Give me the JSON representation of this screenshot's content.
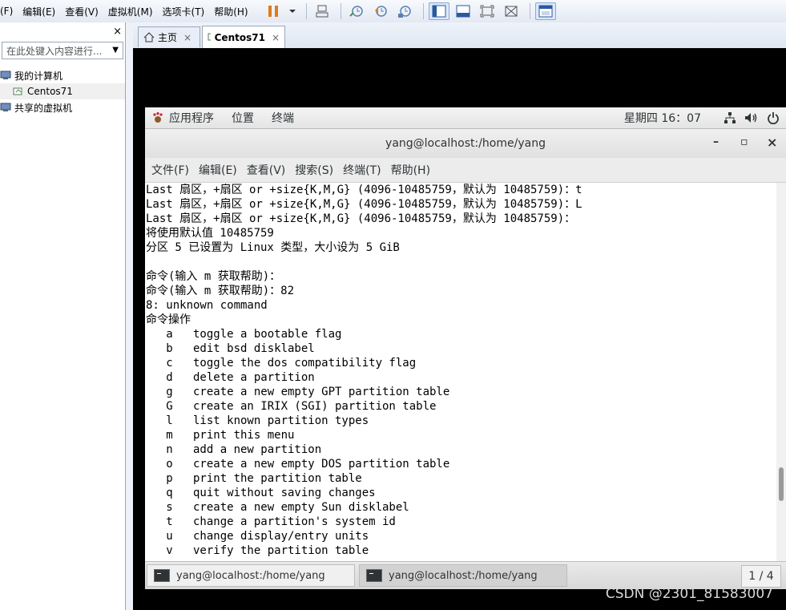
{
  "vmware": {
    "menu": [
      "(F)",
      "编辑(E)",
      "查看(V)",
      "虚拟机(M)",
      "选项卡(T)",
      "帮助(H)"
    ],
    "library": {
      "close": "×",
      "search_placeholder": "在此处键入内容进行...",
      "tree": [
        {
          "label": "我的计算机"
        },
        {
          "label": "Centos71"
        },
        {
          "label": "共享的虚拟机"
        }
      ]
    },
    "tabs": [
      {
        "label": "主页",
        "close": "×"
      },
      {
        "label": "Centos71",
        "close": "×"
      }
    ]
  },
  "gnome": {
    "topbar": {
      "apps": "应用程序",
      "places": "位置",
      "terminal": "终端",
      "clock": "星期四 16：07"
    },
    "window": {
      "title": "yang@localhost:/home/yang",
      "minimize": "–",
      "maximize": "▫",
      "close": "×"
    },
    "term_menu": [
      "文件(F)",
      "编辑(E)",
      "查看(V)",
      "搜索(S)",
      "终端(T)",
      "帮助(H)"
    ],
    "terminal_lines": [
      "Last 扇区，+扇区 or +size{K,M,G} (4096-10485759，默认为 10485759)：t",
      "Last 扇区，+扇区 or +size{K,M,G} (4096-10485759，默认为 10485759)：L",
      "Last 扇区，+扇区 or +size{K,M,G} (4096-10485759，默认为 10485759)：",
      "将使用默认值 10485759",
      "分区 5 已设置为 Linux 类型，大小设为 5 GiB",
      "",
      "命令(输入 m 获取帮助)：",
      "命令(输入 m 获取帮助)：82",
      "8: unknown command",
      "命令操作",
      "   a   toggle a bootable flag",
      "   b   edit bsd disklabel",
      "   c   toggle the dos compatibility flag",
      "   d   delete a partition",
      "   g   create a new empty GPT partition table",
      "   G   create an IRIX (SGI) partition table",
      "   l   list known partition types",
      "   m   print this menu",
      "   n   add a new partition",
      "   o   create a new empty DOS partition table",
      "   p   print the partition table",
      "   q   quit without saving changes",
      "   s   create a new empty Sun disklabel",
      "   t   change a partition's system id",
      "   u   change display/entry units",
      "   v   verify the partition table"
    ],
    "taskbar": {
      "tasks": [
        "yang@localhost:/home/yang",
        "yang@localhost:/home/yang"
      ],
      "pager": "1 / 4"
    }
  },
  "watermark": "CSDN @2301_81583007"
}
